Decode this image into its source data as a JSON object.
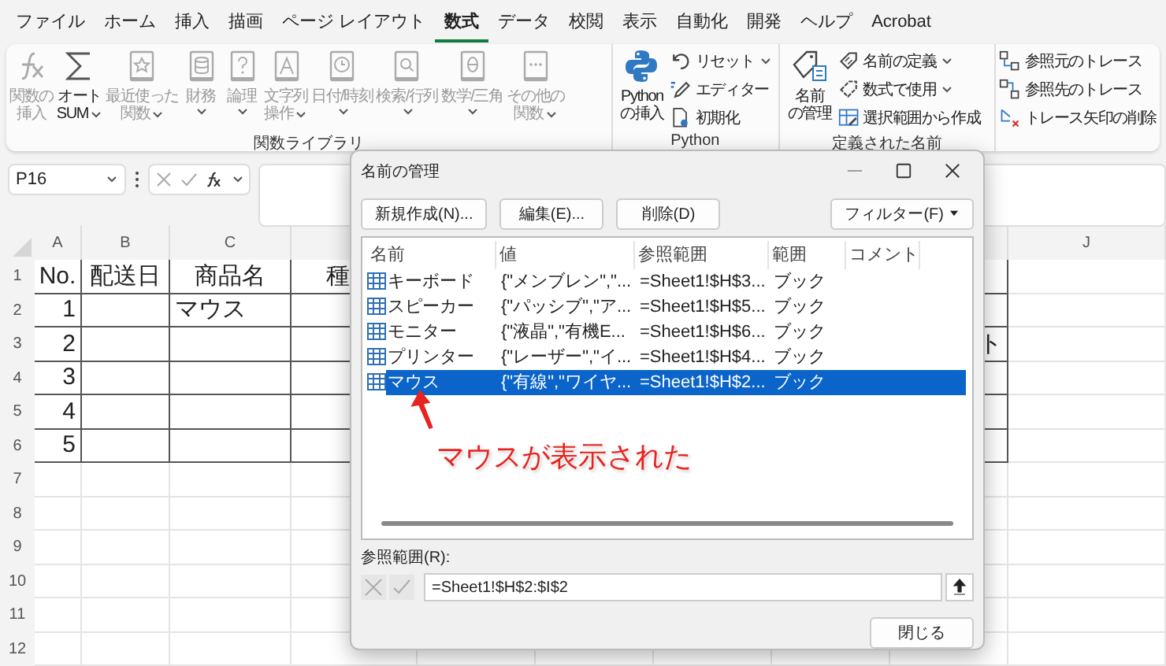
{
  "menu_tabs": [
    {
      "label": "ファイル",
      "selected": false
    },
    {
      "label": "ホーム",
      "selected": false
    },
    {
      "label": "挿入",
      "selected": false
    },
    {
      "label": "描画",
      "selected": false
    },
    {
      "label": "ページ レイアウト",
      "selected": false
    },
    {
      "label": "数式",
      "selected": true
    },
    {
      "label": "データ",
      "selected": false
    },
    {
      "label": "校閲",
      "selected": false
    },
    {
      "label": "表示",
      "selected": false
    },
    {
      "label": "自動化",
      "selected": false
    },
    {
      "label": "開発",
      "selected": false
    },
    {
      "label": "ヘルプ",
      "selected": false
    },
    {
      "label": "Acrobat",
      "selected": false
    }
  ],
  "ribbon": {
    "groups": [
      {
        "label": "関数ライブラリ",
        "items": [
          {
            "kind": "large",
            "lines": [
              "関数の",
              "挿入"
            ],
            "disabled": true,
            "dropdown": false
          },
          {
            "kind": "large",
            "lines": [
              "オート",
              "SUM"
            ],
            "disabled": false,
            "dropdown": true
          },
          {
            "kind": "large",
            "lines": [
              "最近使った",
              "関数"
            ],
            "disabled": true,
            "dropdown": true
          },
          {
            "kind": "large",
            "lines": [
              "財務"
            ],
            "disabled": true,
            "dropdown": true
          },
          {
            "kind": "large",
            "lines": [
              "論理"
            ],
            "disabled": true,
            "dropdown": true
          },
          {
            "kind": "large",
            "lines": [
              "文字列",
              "操作"
            ],
            "disabled": true,
            "dropdown": true
          },
          {
            "kind": "large",
            "lines": [
              "日付/時刻"
            ],
            "disabled": true,
            "dropdown": true
          },
          {
            "kind": "large",
            "lines": [
              "検索/行列"
            ],
            "disabled": true,
            "dropdown": true
          },
          {
            "kind": "large",
            "lines": [
              "数学/三角"
            ],
            "disabled": true,
            "dropdown": true
          },
          {
            "kind": "large",
            "lines": [
              "その他の",
              "関数"
            ],
            "disabled": true,
            "dropdown": true
          }
        ]
      },
      {
        "label": "Python",
        "items": [
          {
            "kind": "large",
            "lines": [
              "Python",
              "の挿入"
            ],
            "disabled": false,
            "dropdown": false
          },
          {
            "kind": "small",
            "lines": [
              "リセット"
            ],
            "disabled": false,
            "dropdown": true
          },
          {
            "kind": "small",
            "lines": [
              "エディター"
            ],
            "disabled": false,
            "dropdown": false
          },
          {
            "kind": "small",
            "lines": [
              "初期化"
            ],
            "disabled": false,
            "dropdown": false
          }
        ]
      },
      {
        "label": "定義された名前",
        "items": [
          {
            "kind": "large",
            "lines": [
              "名前",
              "の管理"
            ],
            "disabled": false,
            "dropdown": false
          },
          {
            "kind": "small",
            "lines": [
              "名前の定義"
            ],
            "disabled": false,
            "dropdown": true
          },
          {
            "kind": "small",
            "lines": [
              "数式で使用"
            ],
            "disabled": false,
            "dropdown": true
          },
          {
            "kind": "small",
            "lines": [
              "選択範囲から作成"
            ],
            "disabled": false,
            "dropdown": false
          }
        ]
      },
      {
        "items": [
          {
            "kind": "small",
            "lines": [
              "参照元のトレース"
            ],
            "disabled": false,
            "dropdown": false
          },
          {
            "kind": "small",
            "lines": [
              "参照先のトレース"
            ],
            "disabled": false,
            "dropdown": false
          },
          {
            "kind": "small",
            "lines": [
              "トレース矢印の削除"
            ],
            "disabled": false,
            "dropdown": false
          }
        ]
      }
    ]
  },
  "formula_bar": {
    "name_box": "P16"
  },
  "sheet": {
    "column_headers": [
      "A",
      "B",
      "C",
      "J"
    ],
    "rows": [
      {
        "number": "1",
        "bordered": true,
        "cells": {
          "A": "No.",
          "B": "配送日",
          "C": "商品名",
          "D": "種"
        }
      },
      {
        "number": "2",
        "bordered": true,
        "cells": {
          "A": "1",
          "C": "マウス"
        }
      },
      {
        "number": "3",
        "bordered": true,
        "cells": {
          "A": "2",
          "I": "ト"
        }
      },
      {
        "number": "4",
        "bordered": true,
        "cells": {
          "A": "3"
        }
      },
      {
        "number": "5",
        "bordered": true,
        "cells": {
          "A": "4"
        }
      },
      {
        "number": "6",
        "bordered": true,
        "cells": {
          "A": "5"
        }
      },
      {
        "number": "7",
        "bordered": false,
        "cells": {}
      },
      {
        "number": "8",
        "bordered": false,
        "cells": {}
      },
      {
        "number": "9",
        "bordered": false,
        "cells": {}
      },
      {
        "number": "10",
        "bordered": false,
        "cells": {}
      },
      {
        "number": "11",
        "bordered": false,
        "cells": {}
      },
      {
        "number": "12",
        "bordered": false,
        "cells": {}
      }
    ]
  },
  "dialog": {
    "title": "名前の管理",
    "buttons": [
      "新規作成(N)...",
      "編集(E)...",
      "削除(D)"
    ],
    "filter_button": "フィルター(F)",
    "columns": [
      "名前",
      "値",
      "参照範囲",
      "範囲",
      "コメント"
    ],
    "names": [
      {
        "name": "キーボード",
        "value": "{\"メンブレン\",\"...",
        "refers_to": "=Sheet1!$H$3...",
        "scope": "ブック",
        "selected": false
      },
      {
        "name": "スピーカー",
        "value": "{\"パッシブ\",\"ア...",
        "refers_to": "=Sheet1!$H$5...",
        "scope": "ブック",
        "selected": false
      },
      {
        "name": "モニター",
        "value": "{\"液晶\",\"有機E...",
        "refers_to": "=Sheet1!$H$6...",
        "scope": "ブック",
        "selected": false
      },
      {
        "name": "プリンター",
        "value": "{\"レーザー\",\"イ...",
        "refers_to": "=Sheet1!$H$4...",
        "scope": "ブック",
        "selected": false
      },
      {
        "name": "マウス",
        "value": "{\"有線\",\"ワイヤ...",
        "refers_to": "=Sheet1!$H$2...",
        "scope": "ブック",
        "selected": true
      }
    ],
    "refers_to_label": "参照範囲(R):",
    "refers_to_value": "=Sheet1!$H$2:$I$2",
    "close_button": "閉じる"
  },
  "annotation": {
    "text": "マウスが表示された"
  }
}
